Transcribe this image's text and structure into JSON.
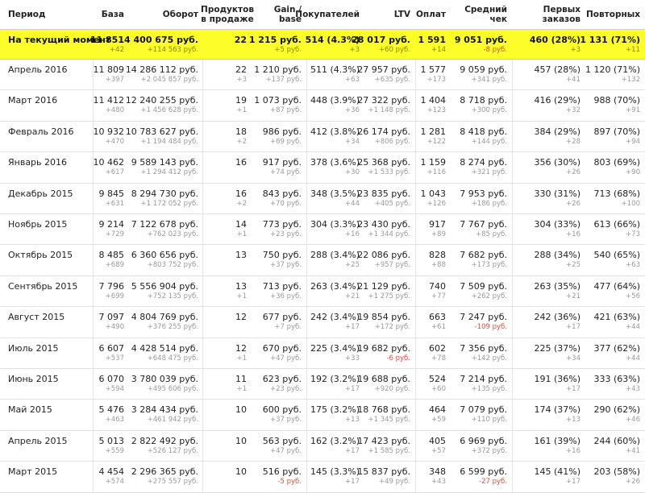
{
  "headers": {
    "period": "Период",
    "base": "База",
    "turnover": "Оборот",
    "products": "Продуктов в продаже",
    "gain": "Gain / base",
    "buyers": "Покупателей",
    "ltv": "LTV",
    "payments": "Оплат",
    "avg": "Средний чек",
    "first": "Первых заказов",
    "repeat": "Повторных"
  },
  "current": {
    "period": "На текущий момент",
    "base": "11 851",
    "base_d": "+42",
    "turnover": "14 400 675 руб.",
    "turnover_d": "+114 563 руб.",
    "products": "22",
    "gain": "1 215 руб.",
    "gain_d": "+5 руб.",
    "buyers": "514 (4.3%)",
    "buyers_d": "+3",
    "ltv": "28 017 руб.",
    "ltv_d": "+60 руб.",
    "payments": "1 591",
    "payments_d": "+14",
    "avg": "9 051 руб.",
    "avg_d": "-8 руб.",
    "first": "460 (28%)",
    "first_d": "+3",
    "repeat": "1 131 (71%)",
    "repeat_d": "+11"
  },
  "rows": [
    {
      "period": "Апрель 2016",
      "base": "11 809",
      "base_d": "+397",
      "turnover": "14 286 112 руб.",
      "turnover_d": "+2 045 857 руб.",
      "products": "22",
      "products_d": "+3",
      "gain": "1 210 руб.",
      "gain_d": "+137 руб.",
      "buyers": "511 (4.3%)",
      "buyers_d": "+63",
      "ltv": "27 957 руб.",
      "ltv_d": "+635 руб.",
      "payments": "1 577",
      "payments_d": "+173",
      "avg": "9 059 руб.",
      "avg_d": "+341 руб.",
      "first": "457 (28%)",
      "first_d": "+41",
      "repeat": "1 120 (71%)",
      "repeat_d": "+132"
    },
    {
      "period": "Март 2016",
      "base": "11 412",
      "base_d": "+480",
      "turnover": "12 240 255 руб.",
      "turnover_d": "+1 456 628 руб.",
      "products": "19",
      "products_d": "+1",
      "gain": "1 073 руб.",
      "gain_d": "+87 руб.",
      "buyers": "448 (3.9%)",
      "buyers_d": "+36",
      "ltv": "27 322 руб.",
      "ltv_d": "+1 148 руб.",
      "payments": "1 404",
      "payments_d": "+123",
      "avg": "8 718 руб.",
      "avg_d": "+300 руб.",
      "first": "416 (29%)",
      "first_d": "+32",
      "repeat": "988 (70%)",
      "repeat_d": "+91"
    },
    {
      "period": "Февраль 2016",
      "base": "10 932",
      "base_d": "+470",
      "turnover": "10 783 627 руб.",
      "turnover_d": "+1 194 484 руб.",
      "products": "18",
      "products_d": "+2",
      "gain": "986 руб.",
      "gain_d": "+69 руб.",
      "buyers": "412 (3.8%)",
      "buyers_d": "+34",
      "ltv": "26 174 руб.",
      "ltv_d": "+806 руб.",
      "payments": "1 281",
      "payments_d": "+122",
      "avg": "8 418 руб.",
      "avg_d": "+144 руб.",
      "first": "384 (29%)",
      "first_d": "+28",
      "repeat": "897 (70%)",
      "repeat_d": "+94"
    },
    {
      "period": "Январь 2016",
      "base": "10 462",
      "base_d": "+617",
      "turnover": "9 589 143 руб.",
      "turnover_d": "+1 294 412 руб.",
      "products": "16",
      "products_d": "",
      "gain": "917 руб.",
      "gain_d": "+74 руб.",
      "buyers": "378 (3.6%)",
      "buyers_d": "+30",
      "ltv": "25 368 руб.",
      "ltv_d": "+1 533 руб.",
      "payments": "1 159",
      "payments_d": "+116",
      "avg": "8 274 руб.",
      "avg_d": "+321 руб.",
      "first": "356 (30%)",
      "first_d": "+26",
      "repeat": "803 (69%)",
      "repeat_d": "+90"
    },
    {
      "period": "Декабрь 2015",
      "base": "9 845",
      "base_d": "+631",
      "turnover": "8 294 730 руб.",
      "turnover_d": "+1 172 052 руб.",
      "products": "16",
      "products_d": "+2",
      "gain": "843 руб.",
      "gain_d": "+70 руб.",
      "buyers": "348 (3.5%)",
      "buyers_d": "+44",
      "ltv": "23 835 руб.",
      "ltv_d": "+405 руб.",
      "payments": "1 043",
      "payments_d": "+126",
      "avg": "7 953 руб.",
      "avg_d": "+186 руб.",
      "first": "330 (31%)",
      "first_d": "+26",
      "repeat": "713 (68%)",
      "repeat_d": "+100"
    },
    {
      "period": "Ноябрь 2015",
      "base": "9 214",
      "base_d": "+729",
      "turnover": "7 122 678 руб.",
      "turnover_d": "+762 023 руб.",
      "products": "14",
      "products_d": "+1",
      "gain": "773 руб.",
      "gain_d": "+23 руб.",
      "buyers": "304 (3.3%)",
      "buyers_d": "+16",
      "ltv": "23 430 руб.",
      "ltv_d": "+1 344 руб.",
      "payments": "917",
      "payments_d": "+89",
      "avg": "7 767 руб.",
      "avg_d": "+85 руб.",
      "first": "304 (33%)",
      "first_d": "+16",
      "repeat": "613 (66%)",
      "repeat_d": "+73"
    },
    {
      "period": "Октябрь 2015",
      "base": "8 485",
      "base_d": "+689",
      "turnover": "6 360 656 руб.",
      "turnover_d": "+803 752 руб.",
      "products": "13",
      "products_d": "",
      "gain": "750 руб.",
      "gain_d": "+37 руб.",
      "buyers": "288 (3.4%)",
      "buyers_d": "+25",
      "ltv": "22 086 руб.",
      "ltv_d": "+957 руб.",
      "payments": "828",
      "payments_d": "+88",
      "avg": "7 682 руб.",
      "avg_d": "+173 руб.",
      "first": "288 (34%)",
      "first_d": "+25",
      "repeat": "540 (65%)",
      "repeat_d": "+63"
    },
    {
      "period": "Сентябрь 2015",
      "base": "7 796",
      "base_d": "+699",
      "turnover": "5 556 904 руб.",
      "turnover_d": "+752 135 руб.",
      "products": "13",
      "products_d": "+1",
      "gain": "713 руб.",
      "gain_d": "+36 руб.",
      "buyers": "263 (3.4%)",
      "buyers_d": "+21",
      "ltv": "21 129 руб.",
      "ltv_d": "+1 275 руб.",
      "payments": "740",
      "payments_d": "+77",
      "avg": "7 509 руб.",
      "avg_d": "+262 руб.",
      "first": "263 (35%)",
      "first_d": "+21",
      "repeat": "477 (64%)",
      "repeat_d": "+56"
    },
    {
      "period": "Август 2015",
      "base": "7 097",
      "base_d": "+490",
      "turnover": "4 804 769 руб.",
      "turnover_d": "+376 255 руб.",
      "products": "12",
      "products_d": "",
      "gain": "677 руб.",
      "gain_d": "+7 руб.",
      "buyers": "242 (3.4%)",
      "buyers_d": "+17",
      "ltv": "19 854 руб.",
      "ltv_d": "+172 руб.",
      "payments": "663",
      "payments_d": "+61",
      "avg": "7 247 руб.",
      "avg_d": "-109 руб.",
      "first": "242 (36%)",
      "first_d": "+17",
      "repeat": "421 (63%)",
      "repeat_d": "+44"
    },
    {
      "period": "Июль 2015",
      "base": "6 607",
      "base_d": "+537",
      "turnover": "4 428 514 руб.",
      "turnover_d": "+648 475 руб.",
      "products": "12",
      "products_d": "+1",
      "gain": "670 руб.",
      "gain_d": "+47 руб.",
      "buyers": "225 (3.4%)",
      "buyers_d": "+33",
      "ltv": "19 682 руб.",
      "ltv_d": "-6 руб.",
      "payments": "602",
      "payments_d": "+78",
      "avg": "7 356 руб.",
      "avg_d": "+142 руб.",
      "first": "225 (37%)",
      "first_d": "+34",
      "repeat": "377 (62%)",
      "repeat_d": "+44"
    },
    {
      "period": "Июнь 2015",
      "base": "6 070",
      "base_d": "+594",
      "turnover": "3 780 039 руб.",
      "turnover_d": "+495 606 руб.",
      "products": "11",
      "products_d": "+1",
      "gain": "623 руб.",
      "gain_d": "+23 руб.",
      "buyers": "192 (3.2%)",
      "buyers_d": "+17",
      "ltv": "19 688 руб.",
      "ltv_d": "+920 руб.",
      "payments": "524",
      "payments_d": "+60",
      "avg": "7 214 руб.",
      "avg_d": "+135 руб.",
      "first": "191 (36%)",
      "first_d": "+17",
      "repeat": "333 (63%)",
      "repeat_d": "+43"
    },
    {
      "period": "Май 2015",
      "base": "5 476",
      "base_d": "+463",
      "turnover": "3 284 434 руб.",
      "turnover_d": "+461 942 руб.",
      "products": "10",
      "products_d": "",
      "gain": "600 руб.",
      "gain_d": "+37 руб.",
      "buyers": "175 (3.2%)",
      "buyers_d": "+13",
      "ltv": "18 768 руб.",
      "ltv_d": "+1 345 руб.",
      "payments": "464",
      "payments_d": "+59",
      "avg": "7 079 руб.",
      "avg_d": "+110 руб.",
      "first": "174 (37%)",
      "first_d": "+13",
      "repeat": "290 (62%)",
      "repeat_d": "+46"
    },
    {
      "period": "Апрель 2015",
      "base": "5 013",
      "base_d": "+559",
      "turnover": "2 822 492 руб.",
      "turnover_d": "+526 127 руб.",
      "products": "10",
      "products_d": "",
      "gain": "563 руб.",
      "gain_d": "+47 руб.",
      "buyers": "162 (3.2%)",
      "buyers_d": "+17",
      "ltv": "17 423 руб.",
      "ltv_d": "+1 585 руб.",
      "payments": "405",
      "payments_d": "+57",
      "avg": "6 969 руб.",
      "avg_d": "+372 руб.",
      "first": "161 (39%)",
      "first_d": "+16",
      "repeat": "244 (60%)",
      "repeat_d": "+41"
    },
    {
      "period": "Март 2015",
      "base": "4 454",
      "base_d": "+574",
      "turnover": "2 296 365 руб.",
      "turnover_d": "+275 557 руб.",
      "products": "10",
      "products_d": "",
      "gain": "516 руб.",
      "gain_d": "-5 руб.",
      "buyers": "145 (3.3%)",
      "buyers_d": "+17",
      "ltv": "15 837 руб.",
      "ltv_d": "+49 руб.",
      "payments": "348",
      "payments_d": "+43",
      "avg": "6 599 руб.",
      "avg_d": "-27 руб.",
      "first": "145 (41%)",
      "first_d": "+17",
      "repeat": "203 (58%)",
      "repeat_d": "+26"
    }
  ]
}
